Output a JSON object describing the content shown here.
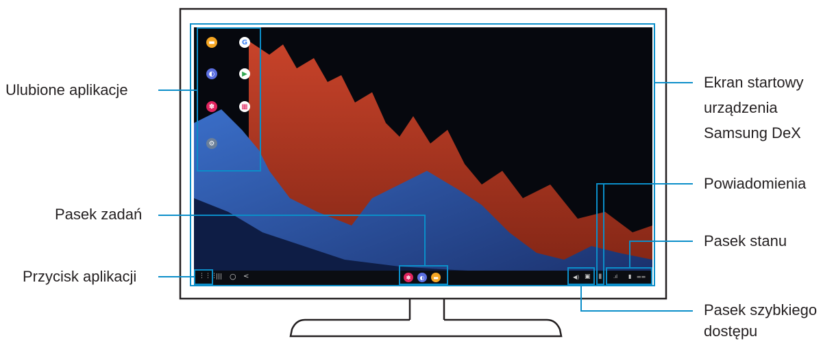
{
  "labels": {
    "favorite_apps": "Ulubione aplikacje",
    "taskbar": "Pasek zadań",
    "apps_button": "Przycisk aplikacji",
    "home_screen": [
      "Ekran startowy",
      "urządzenia",
      "Samsung DeX"
    ],
    "notifications": "Powiadomienia",
    "status_bar": "Pasek stanu",
    "quick_access_bar": [
      "Pasek szybkiego",
      "dostępu"
    ]
  },
  "favorite_apps": [
    {
      "name": "Messages",
      "icon": "messages-icon",
      "color": "#f5a623"
    },
    {
      "name": "Google",
      "icon": "google-icon",
      "color": "#ffffff"
    },
    {
      "name": "Internet",
      "icon": "internet-icon",
      "color": "#5b6fe0"
    },
    {
      "name": "Play Store",
      "icon": "play-store-icon",
      "color": "#ffffff"
    },
    {
      "name": "Gallery",
      "icon": "gallery-icon",
      "color": "#e0245e"
    },
    {
      "name": "Galaxy",
      "icon": "galaxy-icon",
      "color": "#ffffff"
    },
    {
      "name": "Settings",
      "icon": "settings-icon",
      "color": "#6b7f99"
    }
  ],
  "taskbar": {
    "apps_glyph": "⋮⋮⋮",
    "recent_glyph": "|||",
    "home_glyph": "○",
    "back_glyph": "<"
  },
  "colors": {
    "accent": "#0b8ec9",
    "frame": "#231f20"
  }
}
